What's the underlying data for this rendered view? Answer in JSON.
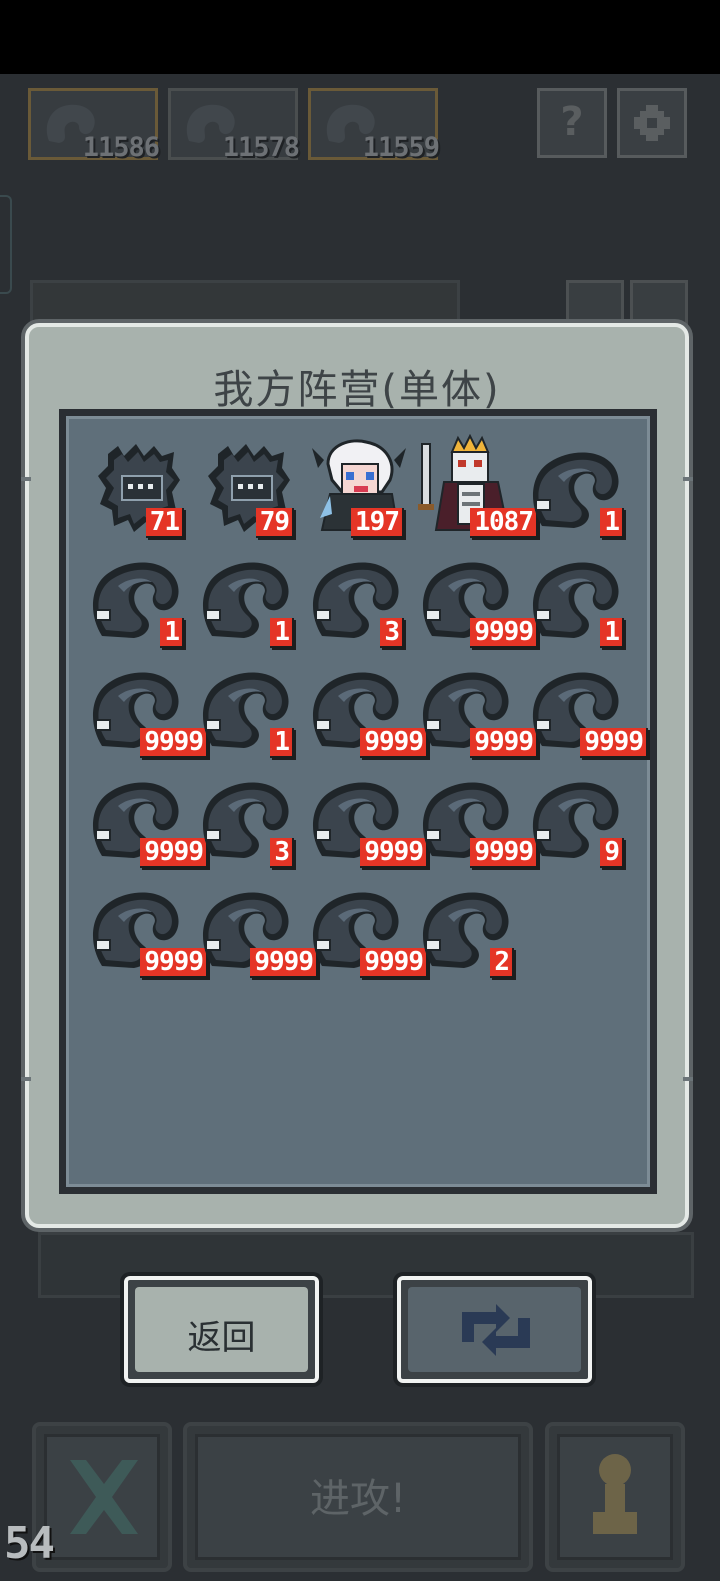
{
  "resources": [
    {
      "name": "resource-slot-1",
      "value": "11586"
    },
    {
      "name": "resource-slot-2",
      "value": "11578"
    },
    {
      "name": "resource-slot-3",
      "value": "11559"
    }
  ],
  "top_buttons": {
    "help_icon": "question-icon",
    "settings_icon": "gear-icon",
    "help_glyph": "?"
  },
  "dialog": {
    "title": "我方阵营(单体)",
    "units": [
      {
        "type": "dark-golem",
        "count": "71"
      },
      {
        "type": "dark-golem",
        "count": "79"
      },
      {
        "type": "demon-girl",
        "count": "197"
      },
      {
        "type": "skeleton-king",
        "count": "1087"
      },
      {
        "type": "shadow-wisp",
        "count": "1"
      },
      {
        "type": "shadow-wisp",
        "count": "1"
      },
      {
        "type": "shadow-wisp",
        "count": "1"
      },
      {
        "type": "shadow-wisp",
        "count": "3"
      },
      {
        "type": "shadow-wisp",
        "count": "9999"
      },
      {
        "type": "shadow-wisp",
        "count": "1"
      },
      {
        "type": "shadow-wisp",
        "count": "9999"
      },
      {
        "type": "shadow-wisp",
        "count": "1"
      },
      {
        "type": "shadow-wisp",
        "count": "9999"
      },
      {
        "type": "shadow-wisp",
        "count": "9999"
      },
      {
        "type": "shadow-wisp",
        "count": "9999"
      },
      {
        "type": "shadow-wisp",
        "count": "9999"
      },
      {
        "type": "shadow-wisp",
        "count": "3"
      },
      {
        "type": "shadow-wisp",
        "count": "9999"
      },
      {
        "type": "shadow-wisp",
        "count": "9999"
      },
      {
        "type": "shadow-wisp",
        "count": "9"
      },
      {
        "type": "shadow-wisp",
        "count": "9999"
      },
      {
        "type": "shadow-wisp",
        "count": "9999"
      },
      {
        "type": "shadow-wisp",
        "count": "9999"
      },
      {
        "type": "shadow-wisp",
        "count": "2"
      }
    ]
  },
  "buttons": {
    "back_label": "返回",
    "refresh_icon": "refresh-icon"
  },
  "actions": {
    "cancel_icon": "close-icon",
    "attack_label": "进攻!",
    "unit_icon": "pawn-icon"
  },
  "fps": "54",
  "colors": {
    "count_badge": "#e53526",
    "dialog_bg": "#a8b2ad",
    "grid_bg": "#5f6f7a"
  }
}
